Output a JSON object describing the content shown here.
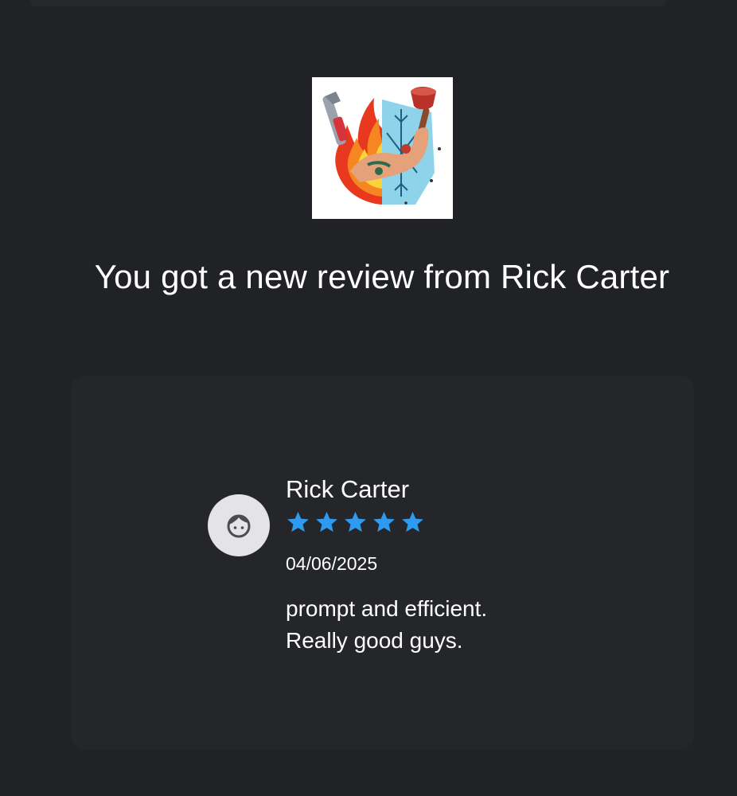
{
  "notification": {
    "headline": "You got a new review from Rick Carter"
  },
  "review": {
    "reviewer_name": "Rick Carter",
    "rating": 5,
    "rating_max": 5,
    "date": "04/06/2025",
    "text_lines": [
      "prompt and efficient.",
      "Really good guys."
    ]
  },
  "icons": {
    "logo": "plumbing-hvac-logo",
    "avatar": "person-face-icon",
    "star": "star-icon"
  },
  "colors": {
    "background": "#212226",
    "card": "#252629",
    "star": "#2e9bf0",
    "avatar_bg": "#e4e4e6",
    "text": "#ffffff"
  }
}
